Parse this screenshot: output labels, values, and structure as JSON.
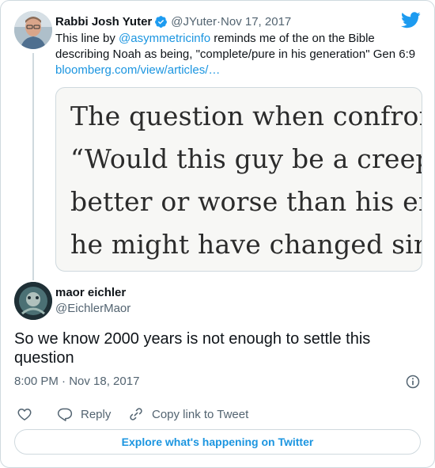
{
  "colors": {
    "accent": "#1b95e0",
    "text": "#0f1419",
    "muted": "#536471",
    "border": "#cfd9de"
  },
  "quoted_tweet": {
    "author_name": "Rabbi Josh Yuter",
    "handle": "@JYuter",
    "separator": " · ",
    "date": "Nov 17, 2017",
    "verified_icon": "verified-badge-icon",
    "text_before": "This line by ",
    "mention": "@asymmetricinfo",
    "text_after": " reminds me of the on the Bible describing Noah as being, \"complete/pure in his generation\" Gen 6:9",
    "link": "bloomberg.com/view/articles/…",
    "media_lines": [
      "The question when confront",
      "“Would this guy be a creep i",
      "better or worse than his env",
      "he might have changed sinc"
    ]
  },
  "tweet": {
    "author_name": "maor eichler",
    "handle": "@EichlerMaor",
    "text": "So we know 2000 years is not enough to settle this question",
    "time": "8:00 PM · Nov 18, 2017"
  },
  "actions": {
    "like_icon": "heart-icon",
    "reply_label": "Reply",
    "copy_link_label": "Copy link to Tweet"
  },
  "footer": {
    "explore_label": "Explore what's happening on Twitter"
  }
}
